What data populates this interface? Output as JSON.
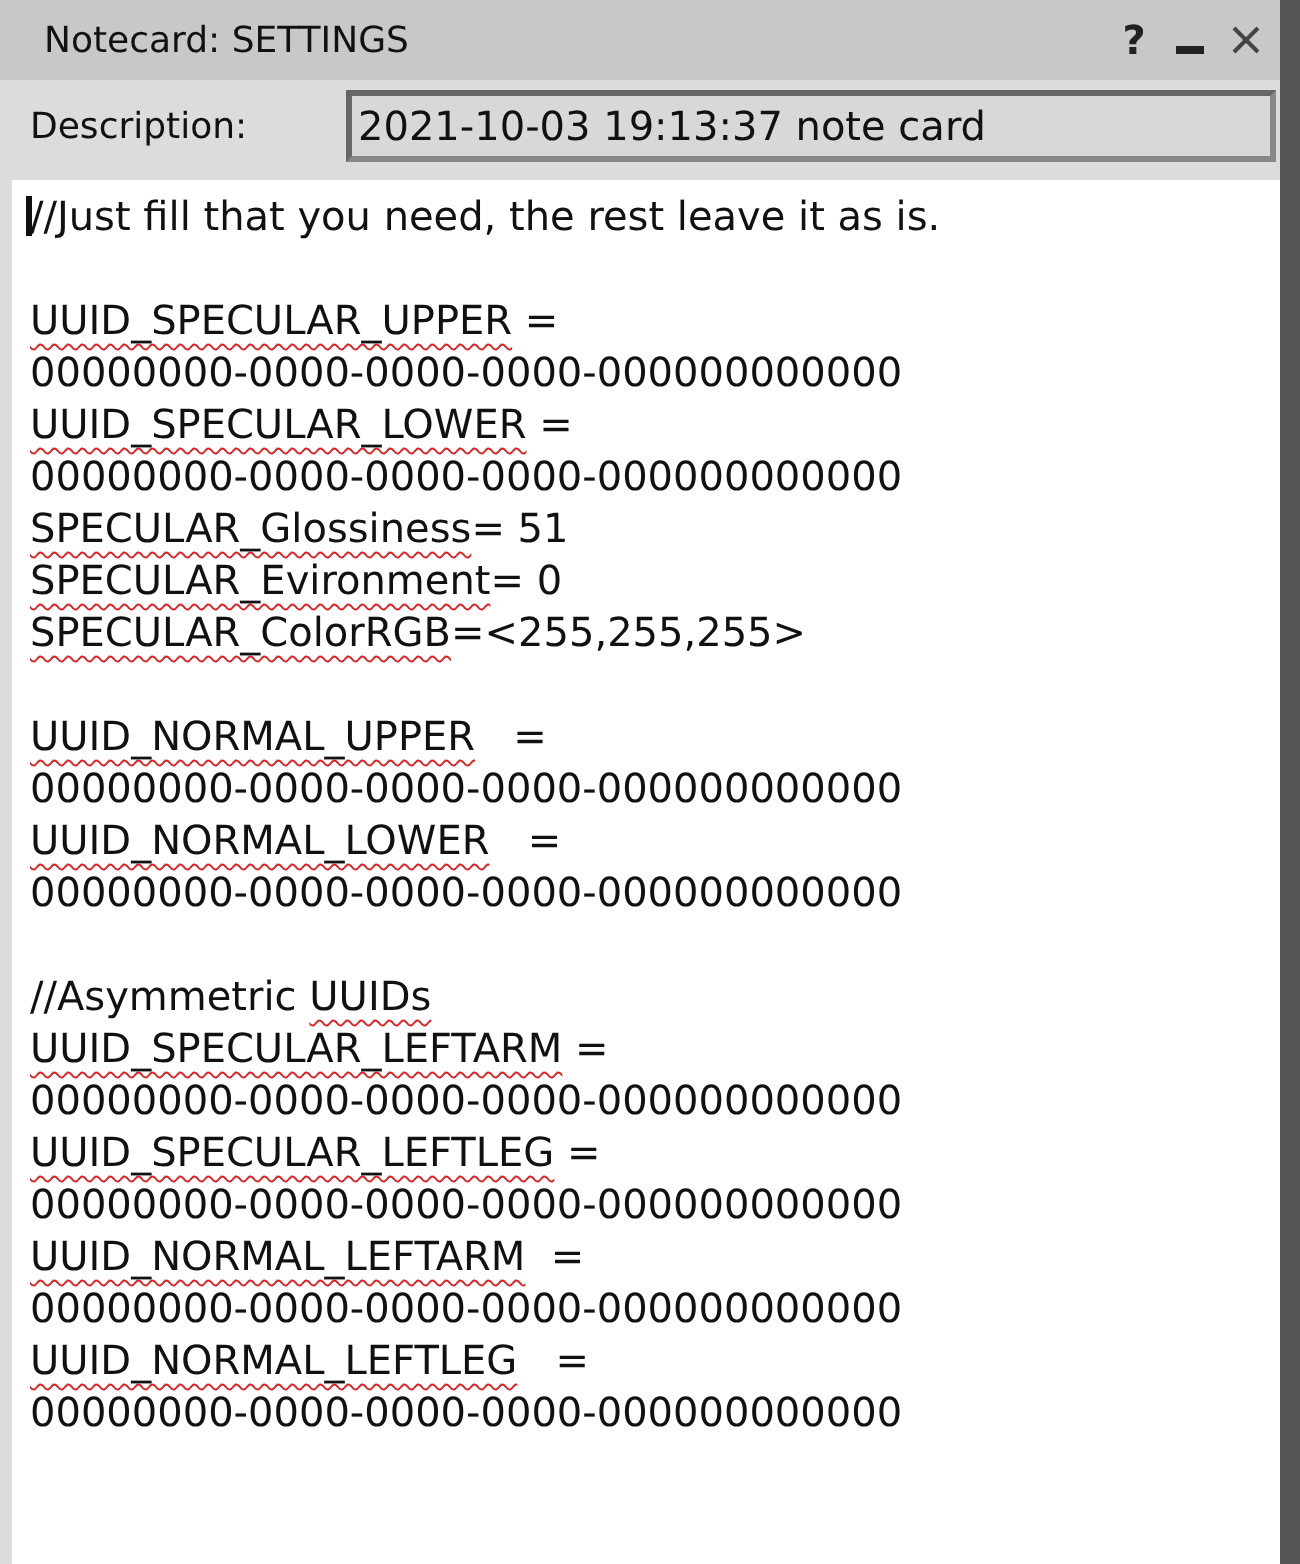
{
  "window": {
    "title": "Notecard: SETTINGS",
    "controls": [
      {
        "kind": "help",
        "label": "?"
      },
      {
        "kind": "minimize"
      },
      {
        "kind": "close"
      }
    ]
  },
  "description": {
    "label": "Description:",
    "value": "2021-10-03 19:13:37 note card"
  },
  "editor": {
    "focused": true,
    "lines": [
      {
        "kind": "text",
        "segments": [
          {
            "text": "//Just fill that you need, the rest leave it as is.",
            "misspelled": false
          }
        ]
      },
      {
        "kind": "blank"
      },
      {
        "kind": "text",
        "segments": [
          {
            "text": "UUID_SPECULAR_UPPER",
            "misspelled": true
          },
          {
            "text": " =",
            "misspelled": false
          }
        ]
      },
      {
        "kind": "text",
        "segments": [
          {
            "text": "00000000-0000-0000-0000-000000000000",
            "misspelled": false
          }
        ]
      },
      {
        "kind": "text",
        "segments": [
          {
            "text": "UUID_SPECULAR_LOWER",
            "misspelled": true
          },
          {
            "text": " =",
            "misspelled": false
          }
        ]
      },
      {
        "kind": "text",
        "segments": [
          {
            "text": "00000000-0000-0000-0000-000000000000",
            "misspelled": false
          }
        ]
      },
      {
        "kind": "text",
        "segments": [
          {
            "text": "SPECULAR_Glossiness",
            "misspelled": true
          },
          {
            "text": "= 51",
            "misspelled": false
          }
        ]
      },
      {
        "kind": "text",
        "segments": [
          {
            "text": "SPECULAR_Evironment",
            "misspelled": true
          },
          {
            "text": "= 0",
            "misspelled": false
          }
        ]
      },
      {
        "kind": "text",
        "segments": [
          {
            "text": "SPECULAR_ColorRGB",
            "misspelled": true
          },
          {
            "text": "=<255,255,255>",
            "misspelled": false
          }
        ]
      },
      {
        "kind": "blank"
      },
      {
        "kind": "text",
        "segments": [
          {
            "text": "UUID_NORMAL_UPPER",
            "misspelled": true
          },
          {
            "text": "   =",
            "misspelled": false
          }
        ]
      },
      {
        "kind": "text",
        "segments": [
          {
            "text": "00000000-0000-0000-0000-000000000000",
            "misspelled": false
          }
        ]
      },
      {
        "kind": "text",
        "segments": [
          {
            "text": "UUID_NORMAL_LOWER",
            "misspelled": true
          },
          {
            "text": "   =",
            "misspelled": false
          }
        ]
      },
      {
        "kind": "text",
        "segments": [
          {
            "text": "00000000-0000-0000-0000-000000000000",
            "misspelled": false
          }
        ]
      },
      {
        "kind": "blank"
      },
      {
        "kind": "text",
        "segments": [
          {
            "text": "//Asymmetric ",
            "misspelled": false
          },
          {
            "text": "UUIDs",
            "misspelled": true
          }
        ]
      },
      {
        "kind": "text",
        "segments": [
          {
            "text": "UUID_SPECULAR_LEFTARM",
            "misspelled": true
          },
          {
            "text": " =",
            "misspelled": false
          }
        ]
      },
      {
        "kind": "text",
        "segments": [
          {
            "text": "00000000-0000-0000-0000-000000000000",
            "misspelled": false
          }
        ]
      },
      {
        "kind": "text",
        "segments": [
          {
            "text": "UUID_SPECULAR_LEFTLEG",
            "misspelled": true
          },
          {
            "text": " =",
            "misspelled": false
          }
        ]
      },
      {
        "kind": "text",
        "segments": [
          {
            "text": "00000000-0000-0000-0000-000000000000",
            "misspelled": false
          }
        ]
      },
      {
        "kind": "text",
        "segments": [
          {
            "text": "UUID_NORMAL_LEFTARM",
            "misspelled": true
          },
          {
            "text": "  =",
            "misspelled": false
          }
        ]
      },
      {
        "kind": "text",
        "segments": [
          {
            "text": "00000000-0000-0000-0000-000000000000",
            "misspelled": false
          }
        ]
      },
      {
        "kind": "text",
        "segments": [
          {
            "text": "UUID_NORMAL_LEFTLEG",
            "misspelled": true
          },
          {
            "text": "   =",
            "misspelled": false
          }
        ]
      },
      {
        "kind": "text",
        "segments": [
          {
            "text": "00000000-0000-0000-0000-000000000000",
            "misspelled": false
          }
        ]
      }
    ]
  }
}
